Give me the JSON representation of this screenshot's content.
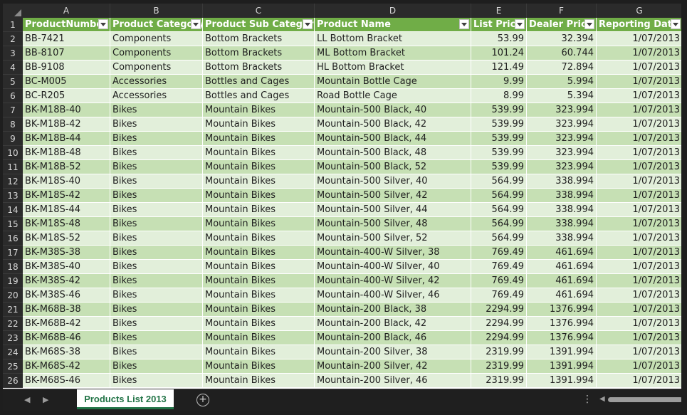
{
  "columns": [
    "A",
    "B",
    "C",
    "D",
    "E",
    "F",
    "G"
  ],
  "headers": [
    "ProductNumber",
    "Product Category",
    "Product Sub Category",
    "Product Name",
    "List Price",
    "Dealer Price",
    "Reporting Date"
  ],
  "rows": [
    [
      "2",
      "BB-7421",
      "Components",
      "Bottom Brackets",
      "LL Bottom Bracket",
      "53.99",
      "32.394",
      "1/07/2013"
    ],
    [
      "3",
      "BB-8107",
      "Components",
      "Bottom Brackets",
      "ML Bottom Bracket",
      "101.24",
      "60.744",
      "1/07/2013"
    ],
    [
      "4",
      "BB-9108",
      "Components",
      "Bottom Brackets",
      "HL Bottom Bracket",
      "121.49",
      "72.894",
      "1/07/2013"
    ],
    [
      "5",
      "BC-M005",
      "Accessories",
      "Bottles and Cages",
      "Mountain Bottle Cage",
      "9.99",
      "5.994",
      "1/07/2013"
    ],
    [
      "6",
      "BC-R205",
      "Accessories",
      "Bottles and Cages",
      "Road Bottle Cage",
      "8.99",
      "5.394",
      "1/07/2013"
    ],
    [
      "7",
      "BK-M18B-40",
      "Bikes",
      "Mountain Bikes",
      "Mountain-500 Black, 40",
      "539.99",
      "323.994",
      "1/07/2013"
    ],
    [
      "8",
      "BK-M18B-42",
      "Bikes",
      "Mountain Bikes",
      "Mountain-500 Black, 42",
      "539.99",
      "323.994",
      "1/07/2013"
    ],
    [
      "9",
      "BK-M18B-44",
      "Bikes",
      "Mountain Bikes",
      "Mountain-500 Black, 44",
      "539.99",
      "323.994",
      "1/07/2013"
    ],
    [
      "10",
      "BK-M18B-48",
      "Bikes",
      "Mountain Bikes",
      "Mountain-500 Black, 48",
      "539.99",
      "323.994",
      "1/07/2013"
    ],
    [
      "11",
      "BK-M18B-52",
      "Bikes",
      "Mountain Bikes",
      "Mountain-500 Black, 52",
      "539.99",
      "323.994",
      "1/07/2013"
    ],
    [
      "12",
      "BK-M18S-40",
      "Bikes",
      "Mountain Bikes",
      "Mountain-500 Silver, 40",
      "564.99",
      "338.994",
      "1/07/2013"
    ],
    [
      "13",
      "BK-M18S-42",
      "Bikes",
      "Mountain Bikes",
      "Mountain-500 Silver, 42",
      "564.99",
      "338.994",
      "1/07/2013"
    ],
    [
      "14",
      "BK-M18S-44",
      "Bikes",
      "Mountain Bikes",
      "Mountain-500 Silver, 44",
      "564.99",
      "338.994",
      "1/07/2013"
    ],
    [
      "15",
      "BK-M18S-48",
      "Bikes",
      "Mountain Bikes",
      "Mountain-500 Silver, 48",
      "564.99",
      "338.994",
      "1/07/2013"
    ],
    [
      "16",
      "BK-M18S-52",
      "Bikes",
      "Mountain Bikes",
      "Mountain-500 Silver, 52",
      "564.99",
      "338.994",
      "1/07/2013"
    ],
    [
      "17",
      "BK-M38S-38",
      "Bikes",
      "Mountain Bikes",
      "Mountain-400-W Silver, 38",
      "769.49",
      "461.694",
      "1/07/2013"
    ],
    [
      "18",
      "BK-M38S-40",
      "Bikes",
      "Mountain Bikes",
      "Mountain-400-W Silver, 40",
      "769.49",
      "461.694",
      "1/07/2013"
    ],
    [
      "19",
      "BK-M38S-42",
      "Bikes",
      "Mountain Bikes",
      "Mountain-400-W Silver, 42",
      "769.49",
      "461.694",
      "1/07/2013"
    ],
    [
      "20",
      "BK-M38S-46",
      "Bikes",
      "Mountain Bikes",
      "Mountain-400-W Silver, 46",
      "769.49",
      "461.694",
      "1/07/2013"
    ],
    [
      "21",
      "BK-M68B-38",
      "Bikes",
      "Mountain Bikes",
      "Mountain-200 Black, 38",
      "2294.99",
      "1376.994",
      "1/07/2013"
    ],
    [
      "22",
      "BK-M68B-42",
      "Bikes",
      "Mountain Bikes",
      "Mountain-200 Black, 42",
      "2294.99",
      "1376.994",
      "1/07/2013"
    ],
    [
      "23",
      "BK-M68B-46",
      "Bikes",
      "Mountain Bikes",
      "Mountain-200 Black, 46",
      "2294.99",
      "1376.994",
      "1/07/2013"
    ],
    [
      "24",
      "BK-M68S-38",
      "Bikes",
      "Mountain Bikes",
      "Mountain-200 Silver, 38",
      "2319.99",
      "1391.994",
      "1/07/2013"
    ],
    [
      "25",
      "BK-M68S-42",
      "Bikes",
      "Mountain Bikes",
      "Mountain-200 Silver, 42",
      "2319.99",
      "1391.994",
      "1/07/2013"
    ],
    [
      "26",
      "BK-M68S-46",
      "Bikes",
      "Mountain Bikes",
      "Mountain-200 Silver, 46",
      "2319.99",
      "1391.994",
      "1/07/2013"
    ]
  ],
  "sheet_tab": "Products List 2013",
  "icons": {
    "prev_sheet": "chevron-left-icon",
    "next_sheet": "chevron-right-icon",
    "add_sheet": "plus-circle-icon",
    "more": "more-vertical-icon",
    "filter": "filter-dropdown-icon"
  },
  "colors": {
    "table_header": "#70ad47",
    "band_light": "#e2efda",
    "band_dark": "#c6e0b4",
    "sheet_tab_text": "#217346"
  }
}
